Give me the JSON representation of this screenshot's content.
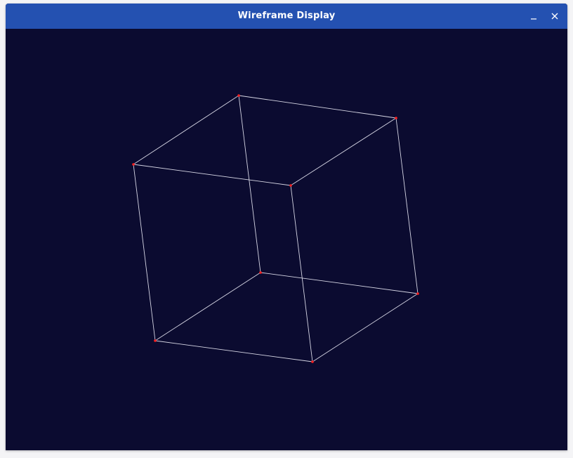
{
  "window": {
    "title": "Wireframe Display",
    "controls": {
      "minimize_icon": "minimize-icon",
      "close_icon": "close-icon"
    }
  },
  "colors": {
    "titlebar": "#2451b1",
    "canvas_background": "#0b0b30",
    "edge": "#d6d6e4",
    "vertex": "#ff2020"
  },
  "wireframe": {
    "type": "cube",
    "vertex_count": 8,
    "edge_count": 12
  }
}
